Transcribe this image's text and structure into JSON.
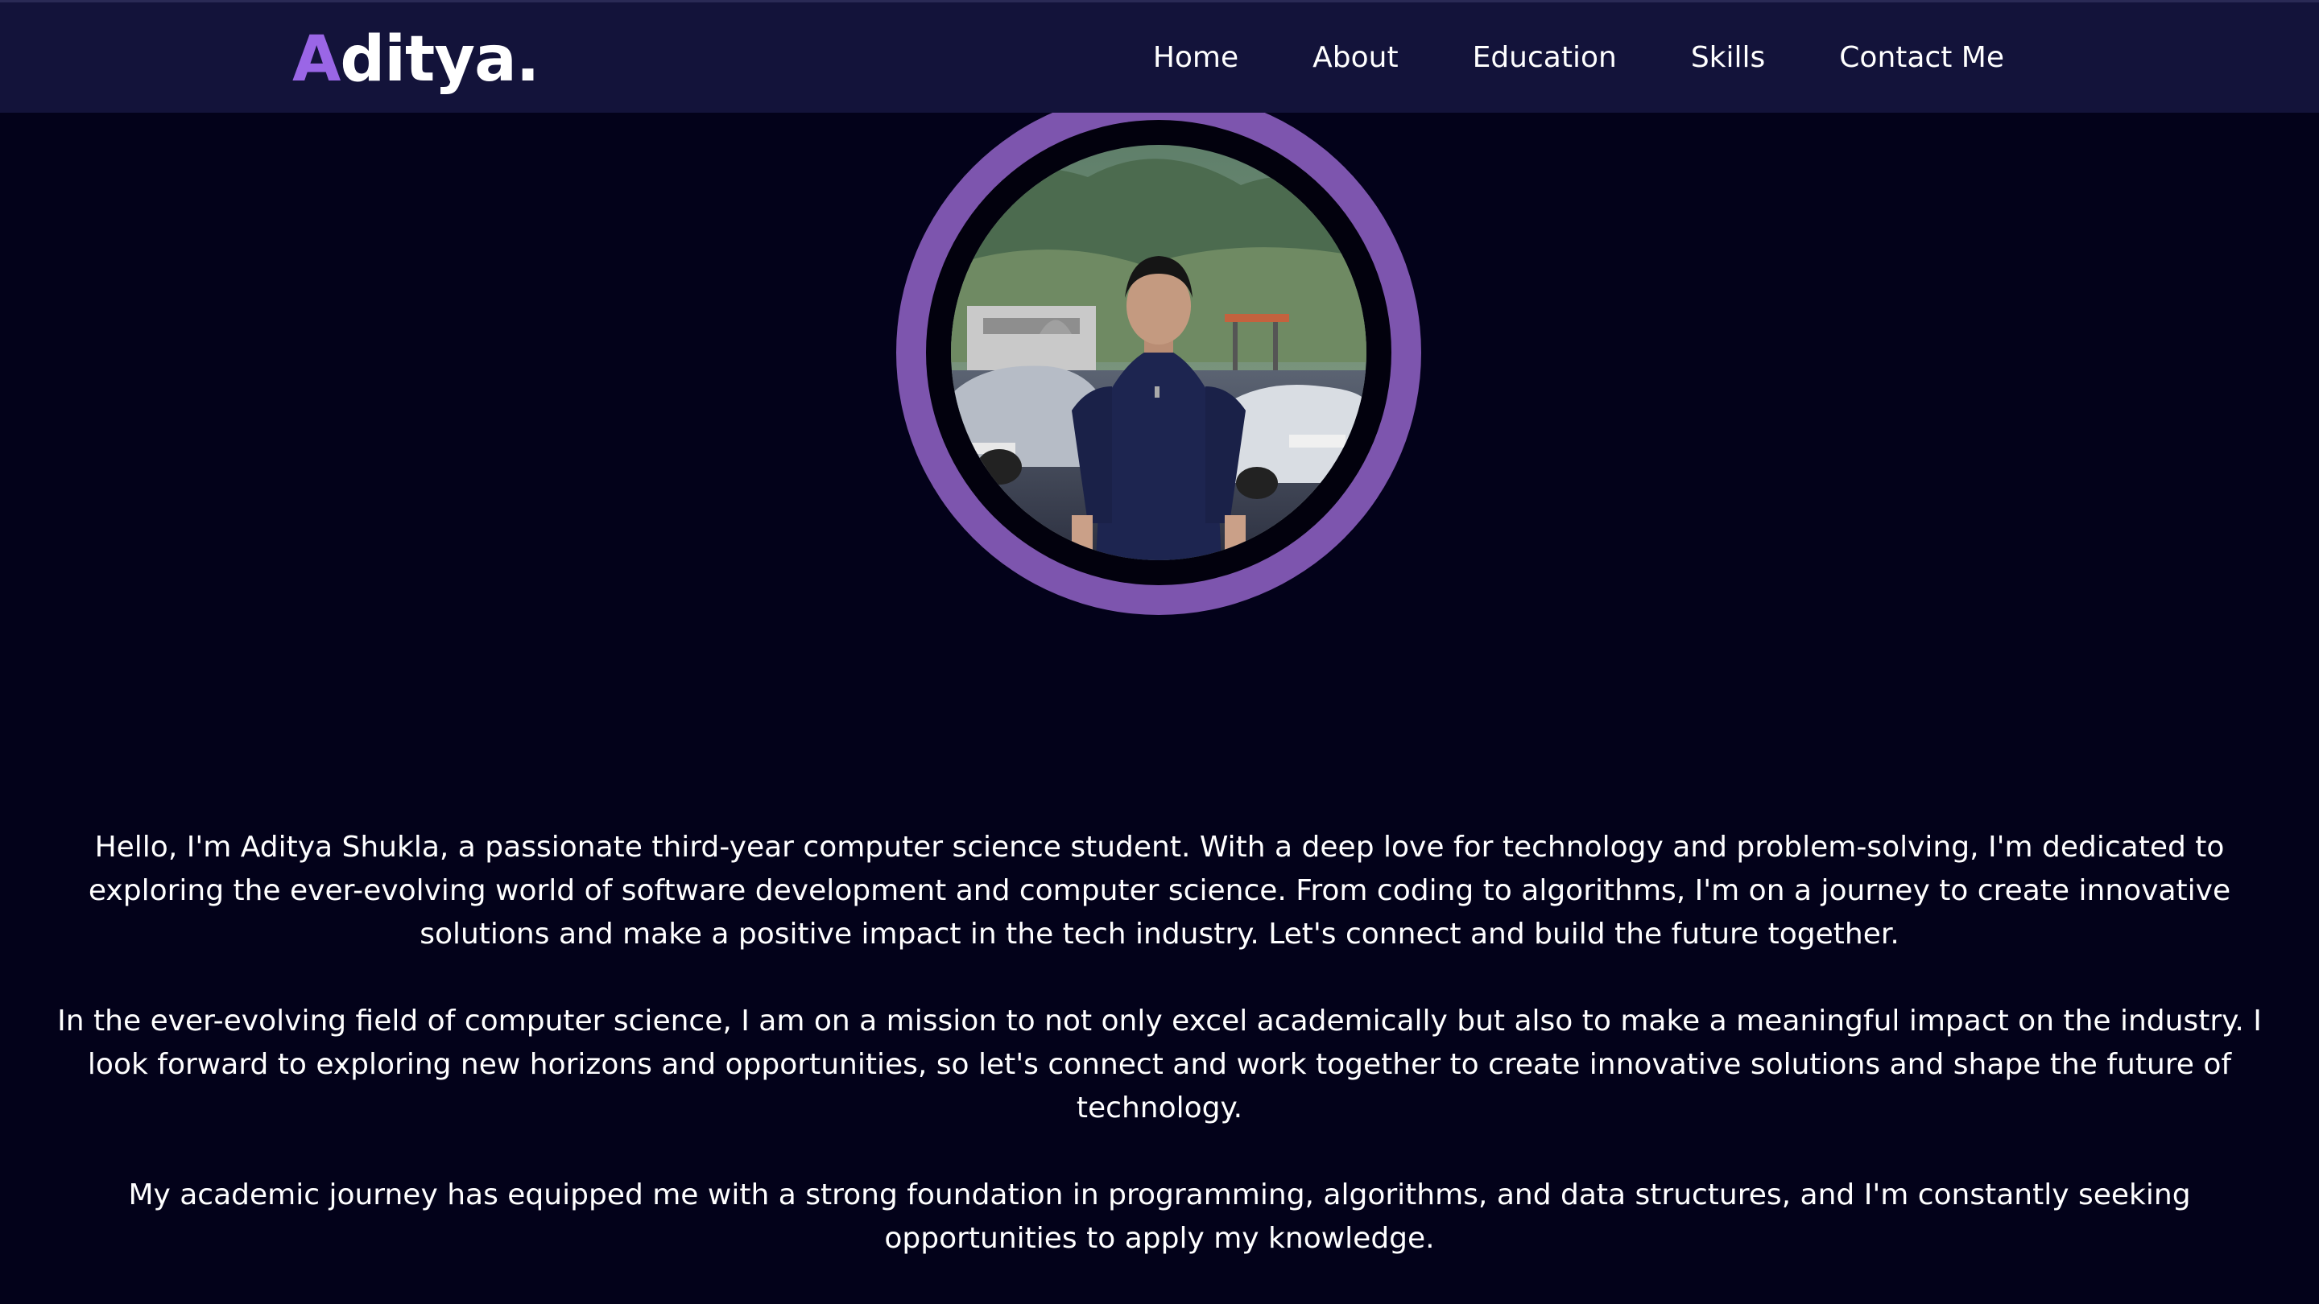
{
  "nav": {
    "brand_initial": "A",
    "brand_rest": "ditya.",
    "links": [
      "Home",
      "About",
      "Education",
      "Skills",
      "Contact Me"
    ]
  },
  "profile": {
    "photo_alt": "Aditya Shukla profile photo"
  },
  "about": {
    "paragraphs": [
      "Hello, I'm Aditya Shukla, a passionate third-year computer science student. With a deep love for technology and problem-solving, I'm dedicated to exploring the ever-evolving world of software development and computer science. From coding to algorithms, I'm on a journey to create innovative solutions and make a positive impact in the tech industry. Let's connect and build the future together.",
      "In the ever-evolving field of computer science, I am on a mission to not only excel academically but also to make a meaningful impact on the industry. I look forward to exploring new horizons and opportunities, so let's connect and work together to create innovative solutions and shape the future of technology.",
      "My academic journey has equipped me with a strong foundation in programming, algorithms, and data structures, and I'm constantly seeking opportunities to apply my knowledge."
    ]
  },
  "colors": {
    "background": "#03021a",
    "navbar": "#13133a",
    "accent": "#9a66e6",
    "ring": "#7d55ae"
  }
}
